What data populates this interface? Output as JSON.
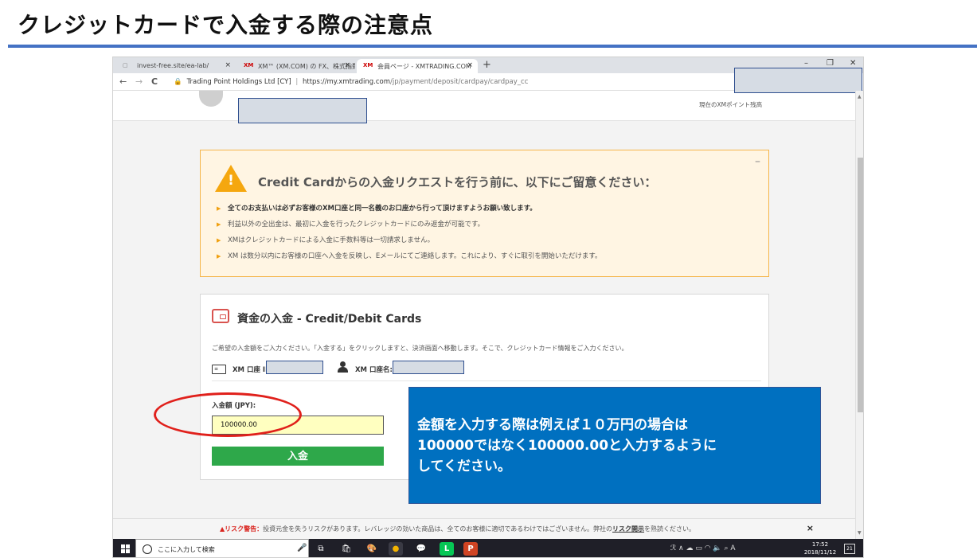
{
  "slide": {
    "title": "クレジットカードで入金する際の注意点"
  },
  "browser": {
    "tabs": [
      {
        "label": "invest-free.site/ea-lab/",
        "favicon": "page-icon"
      },
      {
        "label": "XM™ (XM.COM) の FX、株式指数",
        "favicon": "XM"
      },
      {
        "label": "会員ページ - XMTRADING.COM",
        "favicon": "XM"
      }
    ],
    "close_glyph": "×",
    "new_tab": "+",
    "minimize": "–",
    "restore": "❐",
    "close": "✕",
    "back": "←",
    "forward": "→",
    "reload": "C",
    "lock": "🔒",
    "site_identity": "Trading Point Holdings Ltd [CY]",
    "separator": "|",
    "url_domain": "https://my.xmtrading.com",
    "url_path": "/jp/payment/deposit/cardpay/cardpay_cc"
  },
  "header": {
    "points_caption": "現在のXMポイント残高"
  },
  "warning": {
    "minimize": "–",
    "exclamation": "!",
    "title": "Credit Cardからの入金リクエストを行う前に、以下にご留意ください：",
    "items": [
      "全てのお支払いは必ずお客様のXM口座と同一名義のお口座から行って頂けますようお願い致します。",
      "利益以外の全出金は、最初に入金を行ったクレジットカードにのみ返金が可能です。",
      "XMはクレジットカードによる入金に手数料等は一切請求しません。",
      "XM は数分以内にお客様の口座へ入金を反映し、Eメールにてご連絡します。これにより、すぐに取引を開始いただけます。"
    ]
  },
  "deposit": {
    "title": "資金の入金 - Credit/Debit Cards",
    "instructions": "ご希望の入金額をご入力ください。「入金する」をクリックしますと、決済画面へ移動します。そこで、クレジットカード情報をご入力ください。",
    "id_icon_text": "≡",
    "account_id_label": "XM 口座 ID",
    "account_name_label": "XM 口座名:",
    "amount_label": "入金額 (JPY):",
    "amount_value": "100000.00",
    "submit_label": "入金"
  },
  "callout": {
    "lines": [
      "金額を入力する際は例えば１０万円の場合は",
      "100000ではなく100000.00と入力するように",
      "してください。"
    ]
  },
  "risk": {
    "icon": "▲",
    "warning_label": "リスク警告：",
    "text": "投資元金を失うリスクがあります。レバレッジの効いた商品は、全てのお客様に適切であるわけではございません。弊社の",
    "link": "リスク開示",
    "suffix": "を熟読ください。",
    "close": "×"
  },
  "taskbar": {
    "search_placeholder": "ここに入力して検索",
    "mic": "🎤",
    "apps": [
      {
        "name": "task-view",
        "glyph": "⧉"
      },
      {
        "name": "store",
        "glyph": "🛍"
      },
      {
        "name": "paint",
        "glyph": "🎨"
      },
      {
        "name": "chrome",
        "glyph": "●"
      },
      {
        "name": "messenger",
        "glyph": "💬"
      },
      {
        "name": "line",
        "glyph": "L"
      },
      {
        "name": "powerpoint",
        "glyph": "P"
      }
    ],
    "tray": "ℛ  ∧  ☁  ▭  ◠  🔈  ⌕  A",
    "time": "17:52",
    "date": "2018/11/12",
    "notification_count": "21"
  },
  "colors": {
    "accent_rule": "#4472c4",
    "warning_border": "#f5b54a",
    "deposit_button": "#2ea84a",
    "callout_bg": "#0070c0",
    "highlight_ring": "#e0201b"
  }
}
